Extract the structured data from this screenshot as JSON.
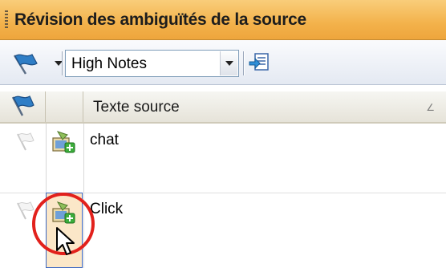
{
  "panel": {
    "title": "Révision des ambiguïtés de la source"
  },
  "toolbar": {
    "flag_dropdown_icon": "flag-icon",
    "filter_value": "High Notes",
    "action_icon": "apply-filter-icon"
  },
  "grid": {
    "columns": [
      {
        "icon": "flag-icon",
        "label": ""
      },
      {
        "icon": "",
        "label": ""
      },
      {
        "icon": "",
        "label": "Texte source"
      }
    ],
    "sort_indicator": "∠",
    "rows": [
      {
        "flag_icon": "white-flag-icon",
        "action_icon": "add-term-icon",
        "source_text": "chat"
      },
      {
        "flag_icon": "white-flag-icon",
        "action_icon": "add-term-icon",
        "source_text": "Click"
      }
    ]
  },
  "colors": {
    "title_bar": "#f3b24b",
    "highlight_circle": "#e2211c",
    "selection_border": "#3a66c2"
  }
}
